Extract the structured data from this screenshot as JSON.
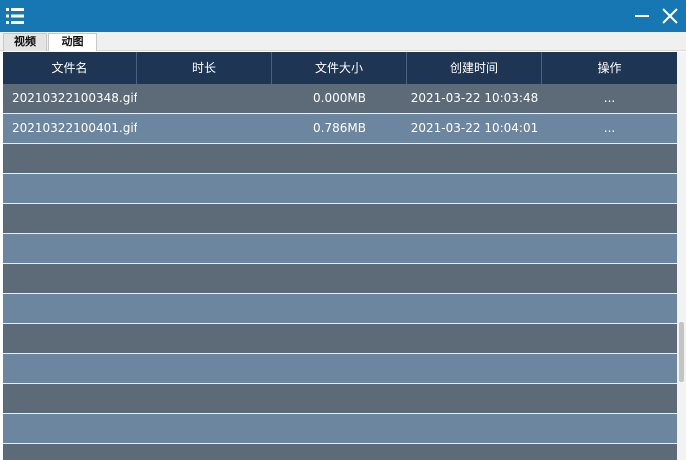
{
  "tabs": [
    {
      "label": "视频",
      "active": false
    },
    {
      "label": "动图",
      "active": true
    }
  ],
  "table": {
    "columns": [
      "文件名",
      "时长",
      "文件大小",
      "创建时间",
      "操作"
    ],
    "rows": [
      {
        "name": "20210322100348.gif",
        "duration": "",
        "size": "0.000MB",
        "created": "2021-03-22 10:03:48",
        "action": "..."
      },
      {
        "name": "20210322100401.gif",
        "duration": "",
        "size": "0.786MB",
        "created": "2021-03-22 10:04:01",
        "action": "..."
      }
    ]
  },
  "colors": {
    "titlebar": "#1677b3",
    "header": "#1e3554",
    "row_dark": "#5d6a78",
    "row_light": "#6d86a0"
  },
  "icons": {
    "menu": "menu-list-icon",
    "minimize": "minimize-icon",
    "close": "close-icon"
  }
}
